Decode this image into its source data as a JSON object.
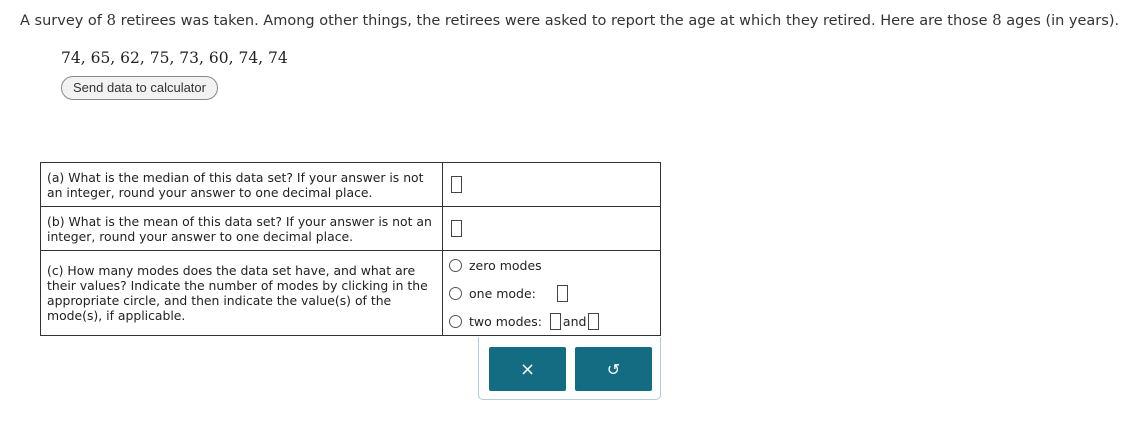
{
  "intro": {
    "before": "A survey of ",
    "count": "8",
    "middle": " retirees was taken. Among other things, the retirees were asked to report the age at which they retired. Here are those ",
    "count2": "8",
    "after": " ages (in years)."
  },
  "data_values": "74, 65, 62, 75, 73, 60, 74, 74",
  "send_button": "Send data to calculator",
  "questions": {
    "a": "(a) What is the median of this data set? If your answer is not an integer, round your answer to one decimal place.",
    "b": "(b) What is the mean of this data set? If your answer is not an integer, round your answer to one decimal place.",
    "c": "(c) How many modes does the data set have, and what are their values? Indicate the number of modes by clicking in the appropriate circle, and then indicate the value(s) of the mode(s), if applicable."
  },
  "modes": {
    "zero": "zero modes",
    "one": "one mode:",
    "two": "two modes:",
    "and": "and"
  },
  "panel": {
    "clear_icon": "×",
    "undo_icon": "↺"
  },
  "colors": {
    "button_bg": "#146c83"
  }
}
